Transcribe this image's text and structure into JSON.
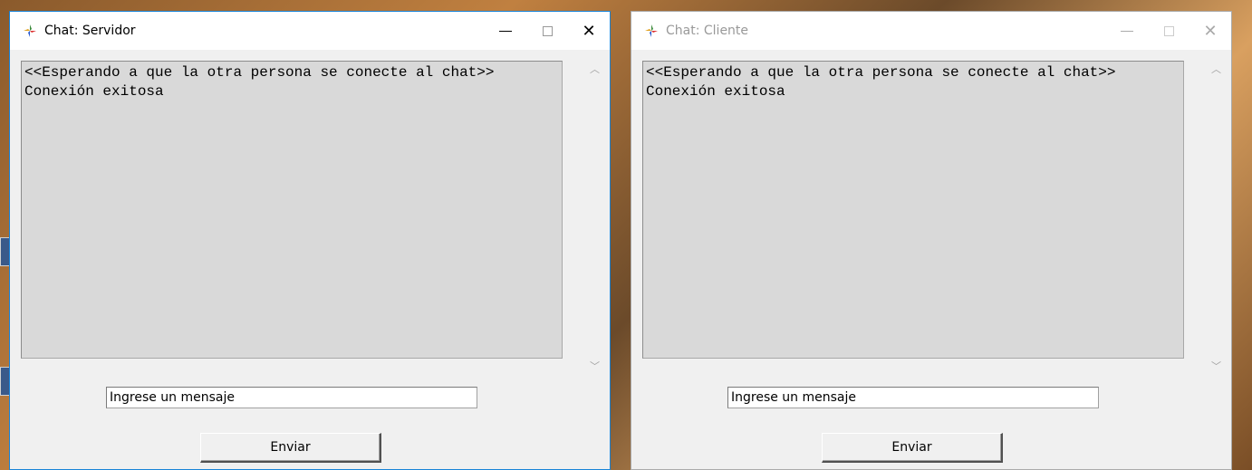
{
  "servidor": {
    "title": "Chat: Servidor",
    "chat_lines": [
      "<<Esperando a que la otra persona se conecte al chat>>",
      "Conexión exitosa"
    ],
    "input_value": "Ingrese un mensaje",
    "send_label": "Enviar",
    "state": "active"
  },
  "cliente": {
    "title": "Chat: Cliente",
    "chat_lines": [
      "<<Esperando a que la otra persona se conecte al chat>>",
      "Conexión exitosa"
    ],
    "input_value": "Ingrese un mensaje",
    "send_label": "Enviar",
    "state": "inactive"
  },
  "titlebar_buttons": {
    "minimize": "—",
    "close": "✕"
  },
  "colors": {
    "active_border": "#1883d7",
    "chat_background": "#d9d9d9"
  }
}
